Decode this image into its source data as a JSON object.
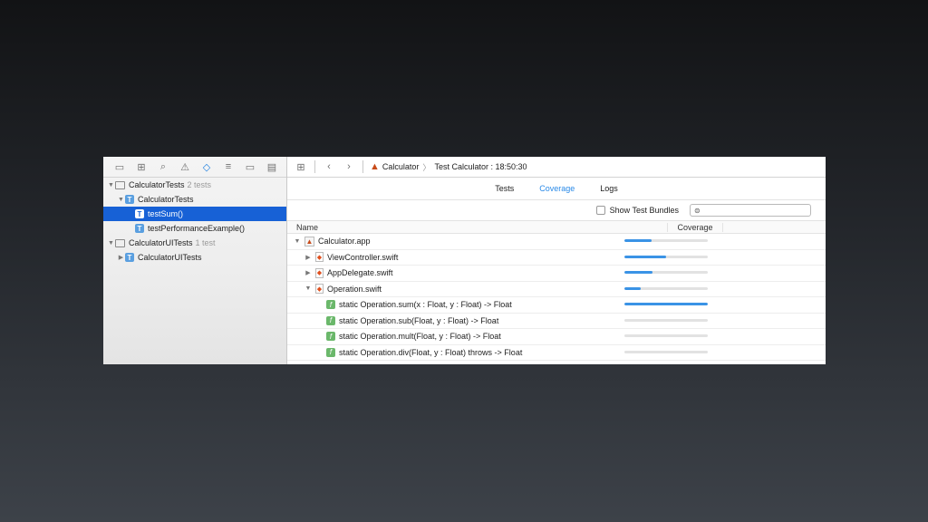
{
  "sidebar": {
    "tools": [
      {
        "icon": "folder-icon",
        "glyph": "▭",
        "active": false
      },
      {
        "icon": "hierarchy-icon",
        "glyph": "⊞",
        "active": false
      },
      {
        "icon": "search-icon",
        "glyph": "⌕",
        "active": false
      },
      {
        "icon": "warning-icon",
        "glyph": "⚠",
        "active": false
      },
      {
        "icon": "test-diamond-icon",
        "glyph": "◇",
        "active": true
      },
      {
        "icon": "debug-icon",
        "glyph": "≡",
        "active": false
      },
      {
        "icon": "breakpoint-icon",
        "glyph": "▭",
        "active": false
      },
      {
        "icon": "report-icon",
        "glyph": "▤",
        "active": false
      }
    ],
    "tree": [
      {
        "label": "CalculatorTests",
        "count": "2 tests",
        "depth": 0,
        "disclosure": "▼",
        "kind": "folder"
      },
      {
        "label": "CalculatorTests",
        "count": "",
        "depth": 1,
        "disclosure": "▼",
        "kind": "test"
      },
      {
        "label": "testSum()",
        "count": "",
        "depth": 2,
        "disclosure": "",
        "kind": "test",
        "selected": true
      },
      {
        "label": "testPerformanceExample()",
        "count": "",
        "depth": 2,
        "disclosure": "",
        "kind": "test"
      },
      {
        "label": "CalculatorUITests",
        "count": "1 test",
        "depth": 0,
        "disclosure": "▼",
        "kind": "folder"
      },
      {
        "label": "CalculatorUITests",
        "count": "",
        "depth": 1,
        "disclosure": "▶",
        "kind": "test"
      }
    ]
  },
  "jumpbar": {
    "app": "Calculator",
    "report": "Test Calculator : 18:50:30"
  },
  "tabs": [
    "Tests",
    "Coverage",
    "Logs"
  ],
  "active_tab": "Coverage",
  "filter": {
    "show_bundles_label": "Show Test Bundles"
  },
  "columns": {
    "name": "Name",
    "coverage": "Coverage"
  },
  "rows": [
    {
      "label": "Calculator.app",
      "depth": 0,
      "disclosure": "▼",
      "kind": "app",
      "coverage": 0.33
    },
    {
      "label": "ViewController.swift",
      "depth": 1,
      "disclosure": "▶",
      "kind": "swift",
      "coverage": 0.5
    },
    {
      "label": "AppDelegate.swift",
      "depth": 1,
      "disclosure": "▶",
      "kind": "swift",
      "coverage": 0.34
    },
    {
      "label": "Operation.swift",
      "depth": 1,
      "disclosure": "▼",
      "kind": "swift",
      "coverage": 0.2
    },
    {
      "label": "static Operation.sum(x : Float, y : Float) -> Float",
      "depth": 2,
      "disclosure": "",
      "kind": "func",
      "coverage": 1.0
    },
    {
      "label": "static Operation.sub(Float, y : Float) -> Float",
      "depth": 2,
      "disclosure": "",
      "kind": "func",
      "coverage": 0
    },
    {
      "label": "static Operation.mult(Float, y : Float) -> Float",
      "depth": 2,
      "disclosure": "",
      "kind": "func",
      "coverage": 0
    },
    {
      "label": "static Operation.div(Float, y : Float) throws -> Float",
      "depth": 2,
      "disclosure": "",
      "kind": "func",
      "coverage": 0
    }
  ]
}
